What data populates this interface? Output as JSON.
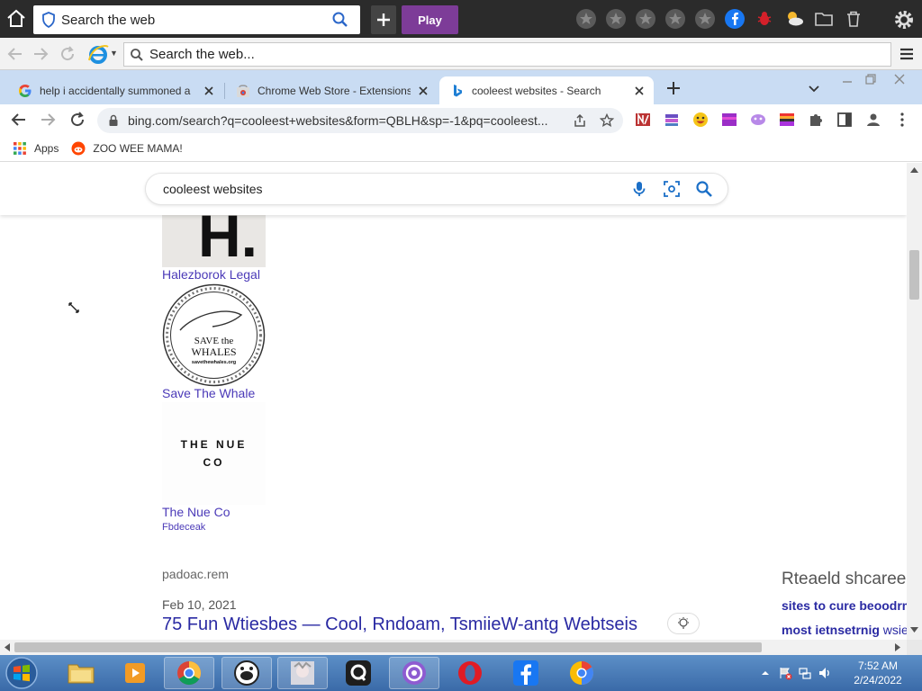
{
  "top_toolbar": {
    "search_placeholder": "Search the web",
    "play_label": "Play"
  },
  "ie_bar": {
    "search_placeholder": "Search the web..."
  },
  "tabs": [
    {
      "label": "help i accidentally summoned a"
    },
    {
      "label": "Chrome Web Store - Extensions"
    },
    {
      "label": "cooleest websites - Search"
    }
  ],
  "address": {
    "url": "bing.com/search?q=cooleest+websites&form=QBLH&sp=-1&pq=cooleest..."
  },
  "bookmarks": [
    {
      "label": "Apps"
    },
    {
      "label": "ZOO WEE MAMA!"
    }
  ],
  "search": {
    "query": "cooleest websites"
  },
  "results": {
    "items": [
      {
        "label": "Halezborok Legal"
      },
      {
        "label": "Save The Whale"
      },
      {
        "label": "The Nue Co",
        "sub": "Fbdeceak"
      }
    ],
    "logo_text": {
      "h_letter": "H.",
      "whale_main": "SAVE the",
      "whale_main2": "WHALES",
      "whale_url": "savethewhales.org",
      "nue_line1": "THE NUE",
      "nue_line2": "CO"
    },
    "domain": "padoac.rem",
    "date": "Feb 10, 2021",
    "title": "75 Fun Wtiesbes — Cool, Rndoam, TsmiieW-antg Webtseis"
  },
  "related": {
    "heading": "Rteaeld shcarees",
    "items": [
      "sites to cure beoodrm",
      "most ietnsetrnig"
    ],
    "item2_suffix": "wsiee"
  },
  "taskbar": {
    "time": "7:52 AM",
    "date": "2/24/2022"
  },
  "colors": {
    "link": "#4b3ab8",
    "title": "#2a2aa3",
    "play": "#7d3c98",
    "tabstrip": "#c9dcf3"
  }
}
